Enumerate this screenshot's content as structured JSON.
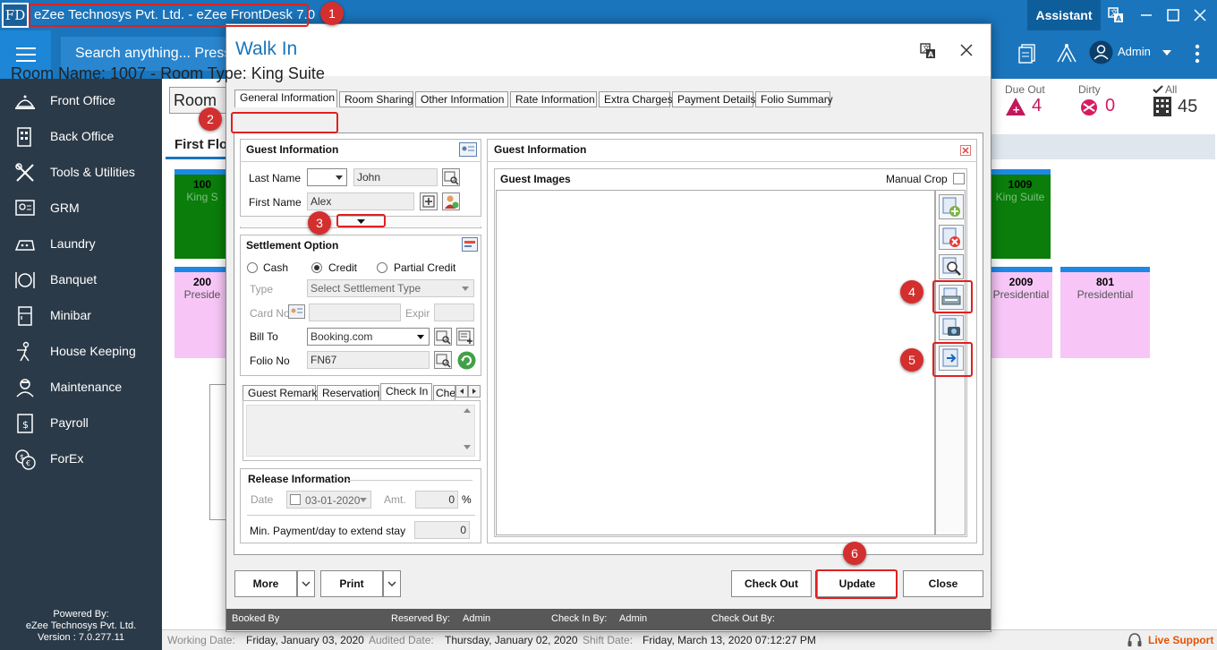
{
  "window": {
    "logo": "FD",
    "title": "eZee Technosys Pvt. Ltd. - eZee FrontDesk 7.0",
    "assistant_label": "Assistant"
  },
  "header": {
    "search_placeholder": "Search anything... Press",
    "user": "Admin"
  },
  "sidebar": {
    "items": [
      {
        "label": "Front Office",
        "icon": "front-office-icon"
      },
      {
        "label": "Back Office",
        "icon": "back-office-icon"
      },
      {
        "label": "Tools & Utilities",
        "icon": "tools-icon"
      },
      {
        "label": "GRM",
        "icon": "grm-icon"
      },
      {
        "label": "Laundry",
        "icon": "laundry-icon"
      },
      {
        "label": "Banquet",
        "icon": "banquet-icon"
      },
      {
        "label": "Minibar",
        "icon": "minibar-icon"
      },
      {
        "label": "House Keeping",
        "icon": "housekeeping-icon"
      },
      {
        "label": "Maintenance",
        "icon": "maintenance-icon"
      },
      {
        "label": "Payroll",
        "icon": "payroll-icon"
      },
      {
        "label": "ForEx",
        "icon": "forex-icon"
      }
    ],
    "powered_by": "Powered By:",
    "company": "eZee Technosys Pvt. Ltd.",
    "version": "Version : 7.0.277.11"
  },
  "background": {
    "room_view": "Room V",
    "first_floor": "First Flo",
    "stats": [
      {
        "label": "Due Out",
        "value": "4",
        "color": "#c2185b"
      },
      {
        "label": "Dirty",
        "value": "0",
        "color": "#d81b60"
      },
      {
        "label": "All",
        "value": "45",
        "color": "#333333"
      }
    ],
    "rooms": [
      {
        "num": "100",
        "type": "King S",
        "color": "#0a7d0a"
      },
      {
        "num": "1009",
        "type": "King Suite",
        "color": "#0a7d0a"
      },
      {
        "num": "200",
        "type": "Preside",
        "color": "#f7c6f7"
      },
      {
        "num": "2009",
        "type": "Presidential",
        "color": "#f7c6f7"
      },
      {
        "num": "801",
        "type": "Presidential",
        "color": "#f7c6f7"
      }
    ]
  },
  "statusbar": {
    "working_label": "Working Date:",
    "working_value": "Friday, January 03, 2020",
    "audited_label": "Audited Date:",
    "audited_value": "Thursday, January 02, 2020",
    "shift_label": "Shift Date:",
    "shift_value": "Friday, March 13, 2020 07:12:27 PM",
    "live_support": "Live Support"
  },
  "dialog": {
    "title": "Walk In",
    "room_heading": "Room Name: 1007 - Room Type: King Suite",
    "tabs": [
      "General Information",
      "Room Sharing",
      "Other Information",
      "Rate Information",
      "Extra Charges",
      "Payment Details",
      "Folio Summary"
    ],
    "guest_info": {
      "title": "Guest Information",
      "last_name_label": "Last Name",
      "last_name_value": "John",
      "first_name_label": "First Name",
      "first_name_value": "Alex"
    },
    "settlement": {
      "title": "Settlement Option",
      "cash": "Cash",
      "credit": "Credit",
      "partial": "Partial Credit",
      "type_label": "Type",
      "type_value": "Select Settlement Type",
      "card_label": "Card No",
      "expiry_label": "Expir",
      "bill_to_label": "Bill To",
      "bill_to_value": "Booking.com",
      "folio_label": "Folio No",
      "folio_value": "FN67"
    },
    "remark_tabs": [
      "Guest Remark",
      "Reservation",
      "Check In",
      "Che"
    ],
    "release": {
      "title": "Release Information",
      "date_label": "Date",
      "date_value": "03-01-2020",
      "amt_label": "Amt.",
      "amt_value": "0",
      "pct": "%",
      "min_label": "Min. Payment/day to extend stay",
      "min_value": "0"
    },
    "right": {
      "title": "Guest Information",
      "images_title": "Guest Images",
      "manual_crop": "Manual Crop"
    },
    "buttons": {
      "more": "More",
      "print": "Print",
      "check_out": "Check Out",
      "update": "Update",
      "close": "Close"
    },
    "footer": {
      "booked_by": "Booked By",
      "reserved_by": "Reserved By:",
      "reserved_by_value": "Admin",
      "check_in_by": "Check In By:",
      "check_in_by_value": "Admin",
      "check_out_by": "Check Out By:"
    }
  },
  "callouts": [
    "1",
    "2",
    "3",
    "4",
    "5",
    "6"
  ]
}
